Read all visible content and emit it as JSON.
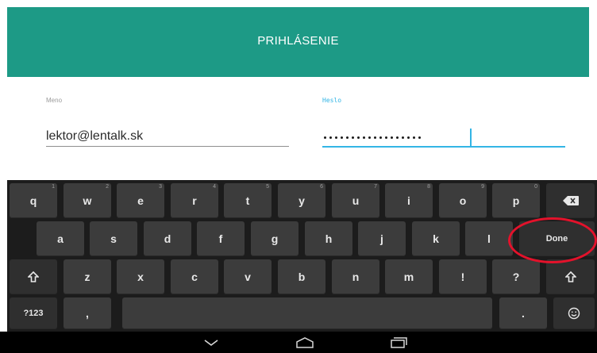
{
  "header": {
    "title": "PRIHLÁSENIE",
    "color": "#1d9a86"
  },
  "form": {
    "email": {
      "label": "Meno",
      "value": "lektor@lentalk.sk"
    },
    "password": {
      "label": "Heslo",
      "masked_length": 18,
      "accent": "#33b5e5"
    }
  },
  "keyboard": {
    "row1": [
      {
        "key": "q",
        "hint": "1"
      },
      {
        "key": "w",
        "hint": "2"
      },
      {
        "key": "e",
        "hint": "3"
      },
      {
        "key": "r",
        "hint": "4"
      },
      {
        "key": "t",
        "hint": "5"
      },
      {
        "key": "y",
        "hint": "6"
      },
      {
        "key": "u",
        "hint": "7"
      },
      {
        "key": "i",
        "hint": "8"
      },
      {
        "key": "o",
        "hint": "9"
      },
      {
        "key": "p",
        "hint": "0"
      }
    ],
    "backspace_icon": "backspace-icon",
    "row2": [
      "a",
      "s",
      "d",
      "f",
      "g",
      "h",
      "j",
      "k",
      "l"
    ],
    "done_label": "Done",
    "shift_icon": "shift-icon",
    "row3": [
      "z",
      "x",
      "c",
      "v",
      "b",
      "n",
      "m",
      "!",
      "?"
    ],
    "symbols_label": "?123",
    "comma_label": ",",
    "period_label": ".",
    "emoji_icon": "smiley-icon"
  },
  "annotation": {
    "circle_color": "#e3122b"
  },
  "navbar": {
    "back_icon": "back-chevron-icon",
    "home_icon": "home-icon",
    "recents_icon": "recents-icon"
  }
}
